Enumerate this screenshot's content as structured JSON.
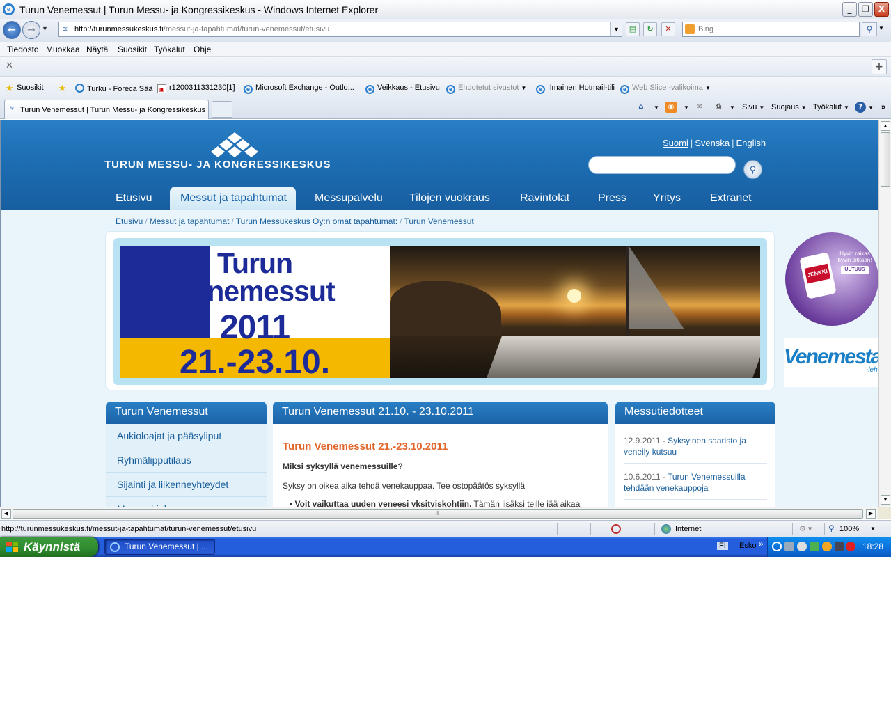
{
  "window": {
    "title": "Turun Venemessut | Turun Messu- ja Kongressikeskus - Windows Internet Explorer",
    "controls": {
      "minimize": "_",
      "maximize": "❐",
      "close": "X"
    }
  },
  "address_bar": {
    "url_domain": "http://turunmessukeskus.fi",
    "url_path": "/messut-ja-tapahtumat/turun-venemessut/etusivu",
    "search_placeholder": "Bing"
  },
  "menu": [
    "Tiedosto",
    "Muokkaa",
    "Näytä",
    "Suosikit",
    "Työkalut",
    "Ohje"
  ],
  "favorites": {
    "label": "Suosikit",
    "items": [
      "Turku - Foreca Sää",
      "r1200311331230[1]",
      "Microsoft Exchange - Outlo...",
      "Veikkaus - Etusivu",
      "Ehdotetut sivustot",
      "Ilmainen Hotmail-tili",
      "Web Slice -valikoima"
    ]
  },
  "tabs": [
    {
      "label": "Turun Venemessut | Turun Messu- ja Kongressikeskus",
      "active": true
    }
  ],
  "command_bar": [
    "Sivu",
    "Suojaus",
    "Työkalut"
  ],
  "site": {
    "logo_text": "TURUN MESSU- JA KONGRESSIKESKUS",
    "languages": [
      "Suomi",
      "Svenska",
      "English"
    ],
    "nav": [
      "Etusivu",
      "Messut ja tapahtumat",
      "Messupalvelu",
      "Tilojen vuokraus",
      "Ravintolat",
      "Press",
      "Yritys",
      "Extranet"
    ],
    "breadcrumb": [
      "Etusivu",
      "Messut ja tapahtumat",
      "Turun Messukeskus Oy:n omat tapahtumat:",
      "Turun Venemessut"
    ],
    "banner": {
      "title_line1": "Turun",
      "title_line2": "Venemessut",
      "year": "2011",
      "dates": "21.-23.10."
    },
    "ads": {
      "jenkki_slogan": "Hyvin raikas hyvin pitkään!",
      "jenkki_badge": "UUTUUS",
      "jenkki_brand": "JENKKI",
      "venemestari_brand": "Venemestari",
      "venemestari_sub": "-lehti"
    },
    "left_box": {
      "title": "Turun Venemessut",
      "items": [
        "Aukioloajat ja pääsyliput",
        "Ryhmälipputilaus",
        "Sijainti ja liikenneyhteydet",
        "Messuohjelma"
      ]
    },
    "main_box": {
      "title": "Turun Venemessut 21.10. - 23.10.2011",
      "heading": "Turun Venemessut 21.-23.10.2011",
      "question": "Miksi syksyllä venemessuille?",
      "paragraph": "Syksy on oikea aika tehdä venekauppaa. Tee ostopäätös syksyllä",
      "bullet_bold": "Voit vaikuttaa uuden veneesi yksityiskohtiin.",
      "bullet_rest": " Tämän lisäksi teille jää aikaa"
    },
    "right_box": {
      "title": "Messutiedotteet",
      "news": [
        {
          "date": "12.9.2011 - ",
          "title": "Syksyinen saaristo ja veneily kutsuu"
        },
        {
          "date": "10.6.2011 - ",
          "title": "Turun Venemessuilla tehdään venekauppoja"
        }
      ]
    }
  },
  "status_bar": {
    "url": "http://turunmessukeskus.fi/messut-ja-tapahtumat/turun-venemessut/etusivu",
    "zone": "Internet",
    "zoom": "100%"
  },
  "taskbar": {
    "start_label": "Käynnistä",
    "window_button": "Turun Venemessut | ...",
    "language": "FI",
    "user": "Esko",
    "time": "18:28"
  },
  "colors": {
    "site_blue": "#1e6fb5",
    "accent_orange": "#e2662b",
    "link_blue": "#1a5e9c",
    "banner_navy": "#1d2b99",
    "banner_yellow": "#f5b800"
  }
}
